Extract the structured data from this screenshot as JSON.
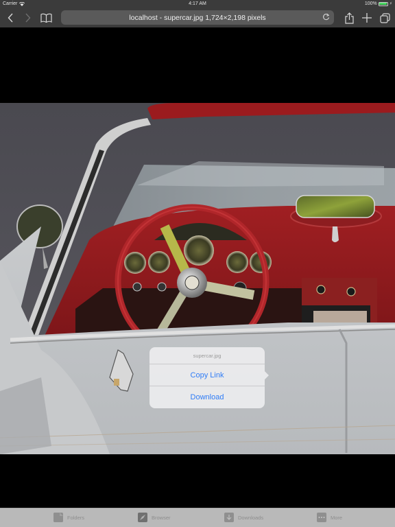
{
  "status_bar": {
    "carrier": "Carrier",
    "time": "4:17 AM",
    "battery": "100%",
    "battery_color": "#4cd964"
  },
  "nav_bar": {
    "back_icon": "chevron-left-icon",
    "forward_icon": "chevron-right-icon",
    "bookmarks_icon": "book-icon",
    "address_text": "localhost - supercar.jpg 1,724×2,198 pixels",
    "reload_icon": "reload-icon",
    "share_icon": "share-icon",
    "new_tab_icon": "plus-icon",
    "tabs_icon": "tabs-icon"
  },
  "content": {
    "image_name": "supercar.jpg",
    "image_size": "1,724×2,198 pixels"
  },
  "popover": {
    "title": "supercar.jpg",
    "items": [
      {
        "label": "Copy Link"
      },
      {
        "label": "Download"
      }
    ],
    "accent_color": "#2f7cf6"
  },
  "tab_bar": {
    "items": [
      {
        "label": "Folders",
        "icon": "folder-icon"
      },
      {
        "label": "Browser",
        "icon": "compass-icon"
      },
      {
        "label": "Downloads",
        "icon": "download-icon"
      },
      {
        "label": "More",
        "icon": "more-icon"
      }
    ]
  }
}
